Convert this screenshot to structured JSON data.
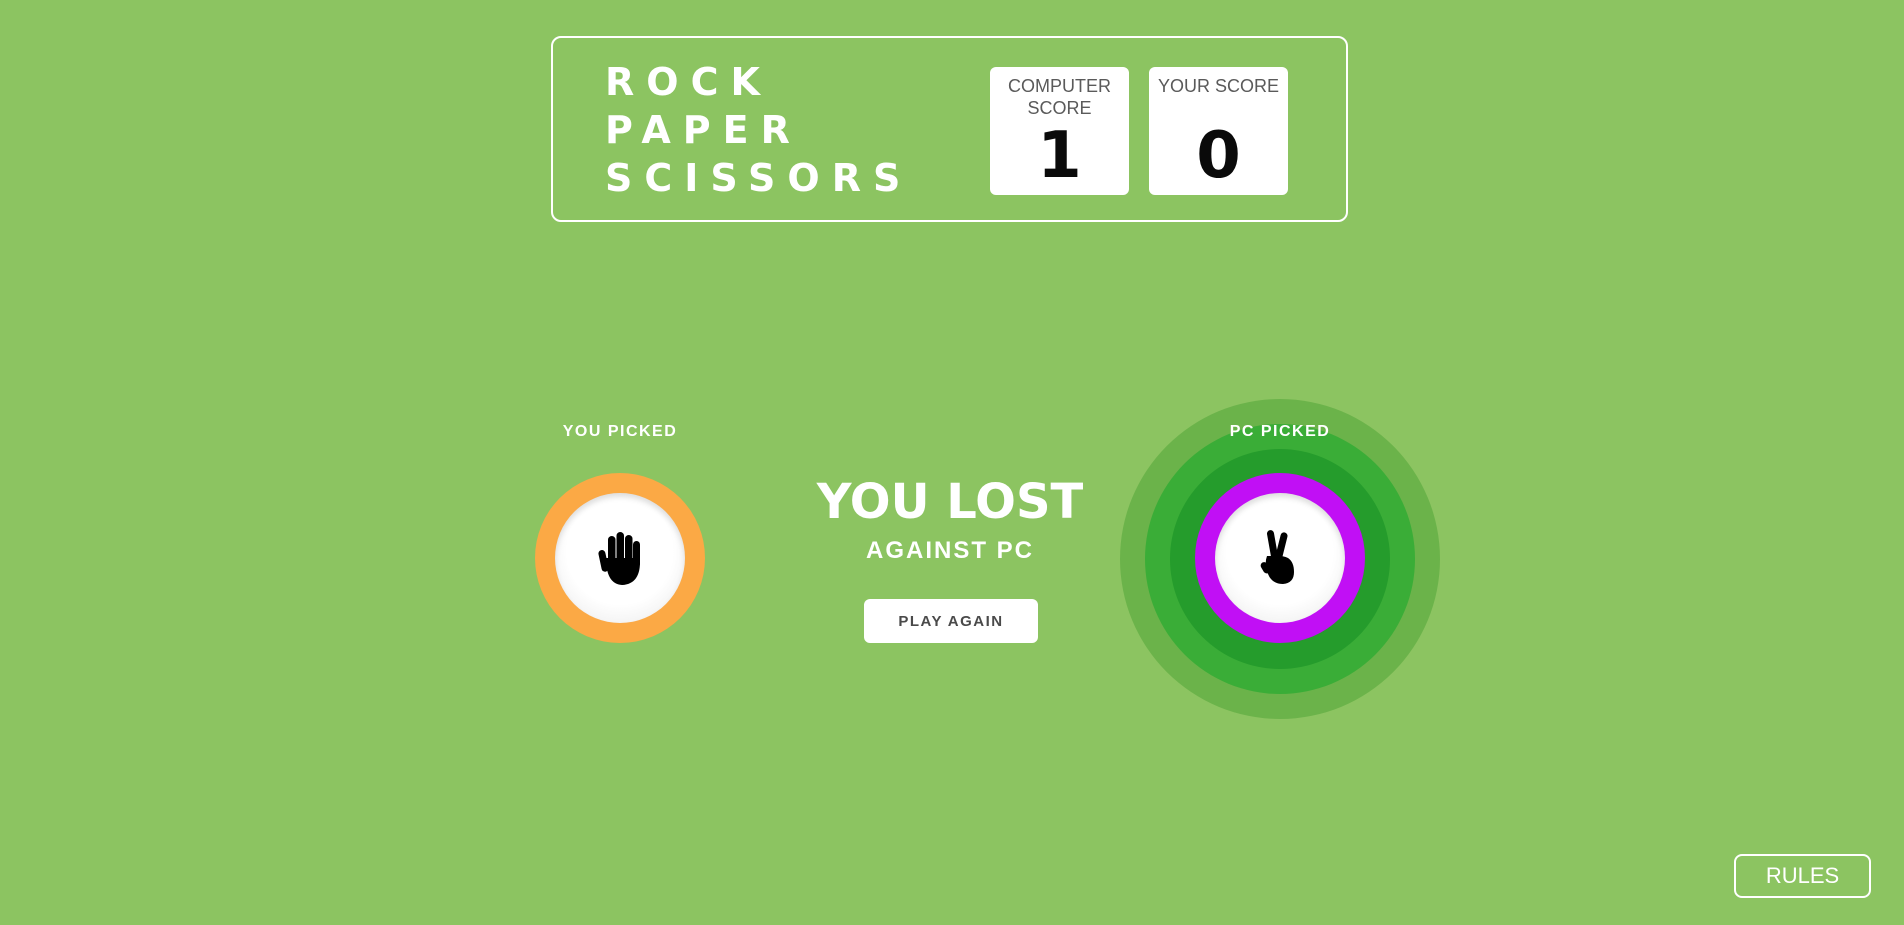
{
  "header": {
    "title_lines": [
      "ROCK",
      "PAPER",
      "SCISSORS"
    ],
    "computer_score": {
      "label": "COMPUTER SCORE",
      "value": "1"
    },
    "your_score": {
      "label": "YOUR SCORE",
      "value": "0"
    }
  },
  "picks": {
    "you": {
      "label": "YOU PICKED",
      "choice": "paper",
      "icon": "raised-hand-icon",
      "ring_color": "#fba945"
    },
    "pc": {
      "label": "PC PICKED",
      "choice": "scissors",
      "icon": "victory-hand-icon",
      "ring_color": "#c10ff5",
      "winner": true
    }
  },
  "result": {
    "title": "YOU LOST",
    "subtitle": "AGAINST PC",
    "play_again_label": "PLAY AGAIN"
  },
  "rules_label": "RULES",
  "colors": {
    "background": "#8cc461",
    "halo_outer": "#6bb34a",
    "halo_middle": "#3aad37",
    "halo_inner": "#259c2c"
  }
}
